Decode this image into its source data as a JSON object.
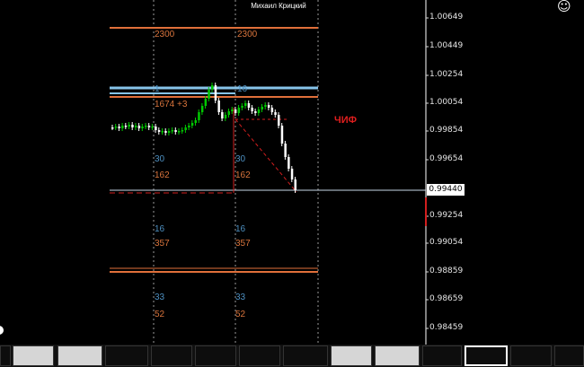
{
  "chart": {
    "title": "Михаил Крицкий",
    "annotation": "ЧИФ",
    "current_price": "0.99440",
    "price_axis": [
      "1.00649",
      "1.00449",
      "1.00254",
      "1.00054",
      "0.99854",
      "0.99654",
      "0.99254",
      "0.99054",
      "0.98859",
      "0.98659",
      "0.98459"
    ],
    "level_labels": {
      "l2300_a": "2300",
      "l2300_b": "2300",
      "l1674": "1674 +3",
      "l16_top": "16",
      "l1_top": "1",
      "l30_a": "30",
      "l30_b": "30",
      "l162_a": "162",
      "l162_b": "162",
      "l16_a": "16",
      "l16_b": "16",
      "l357_a": "357",
      "l357_b": "357",
      "l33_a": "33",
      "l33_b": "33",
      "l52_a": "52",
      "l52_b": "52"
    },
    "colors": {
      "bull": "#00c800",
      "bear": "#ffffff",
      "level_orange": "#e0703a",
      "level_blue": "#87c4ea",
      "dashed_red": "#d21e1e"
    }
  },
  "toolbar": {
    "smiley_icon": "☺"
  }
}
